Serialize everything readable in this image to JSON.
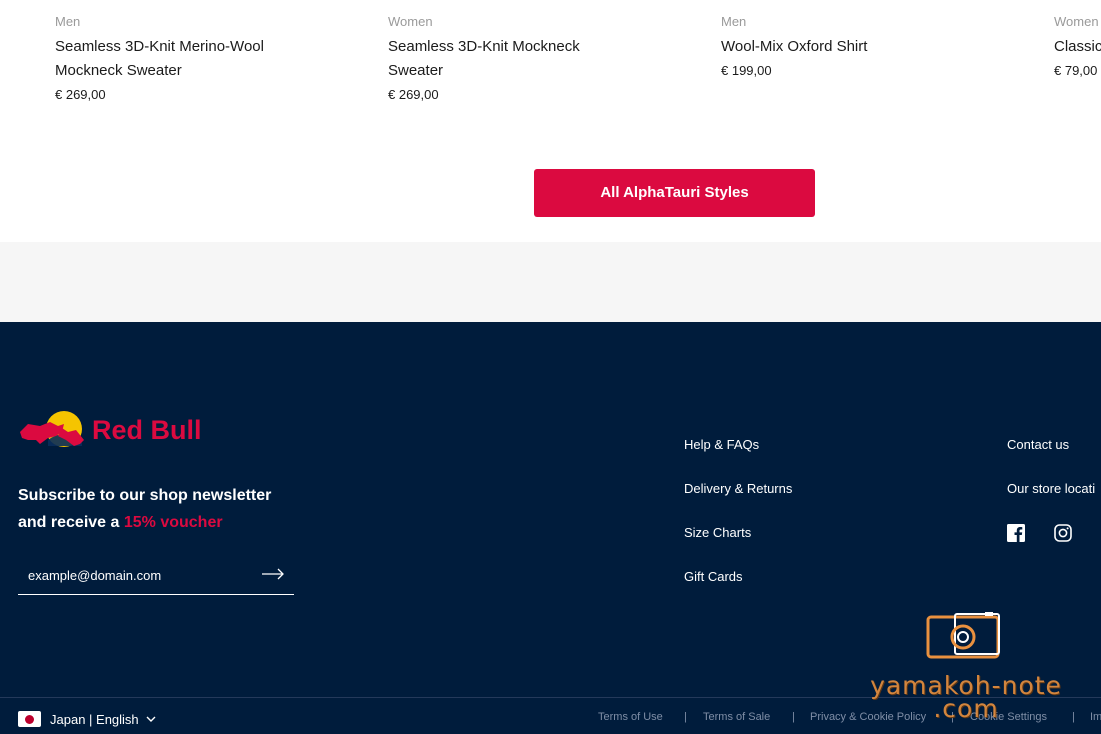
{
  "products": [
    {
      "category": "Men",
      "name": "Seamless 3D-Knit Merino-Wool Mockneck Sweater",
      "price": "€ 269,00"
    },
    {
      "category": "Women",
      "name": "Seamless 3D-Knit Mockneck Sweater",
      "price": "€ 269,00"
    },
    {
      "category": "Men",
      "name": "Wool-Mix Oxford Shirt",
      "price": "€ 199,00"
    },
    {
      "category": "Women",
      "name": "Classic",
      "price": "€ 79,00"
    }
  ],
  "cta_label": "All AlphaTauri Styles",
  "colors": {
    "accent": "#db0a40",
    "footer_bg": "#001c3c",
    "band_bg": "#f6f6f6"
  },
  "footer": {
    "logo_text": "Red Bull",
    "newsletter": {
      "line1": "Subscribe to our shop newsletter",
      "line2_prefix": "and receive a",
      "line2_accent": "15% voucher",
      "placeholder": "example@domain.com",
      "submit_icon": "arrow-right-icon"
    },
    "links_col1": [
      "Help & FAQs",
      "Delivery & Returns",
      "Size Charts",
      "Gift Cards"
    ],
    "links_col2": [
      "Contact us",
      "Our store locati"
    ],
    "social": [
      "facebook-icon",
      "instagram-icon"
    ],
    "locale": {
      "label": "Japan | English",
      "flag": "japan-flag-icon"
    },
    "legal": [
      "Terms of Use",
      "Terms of Sale",
      "Privacy & Cookie Policy",
      "Cookie Settings",
      "Im"
    ]
  },
  "watermark": {
    "line1": "yamakoh-note",
    "line2": ".com"
  }
}
